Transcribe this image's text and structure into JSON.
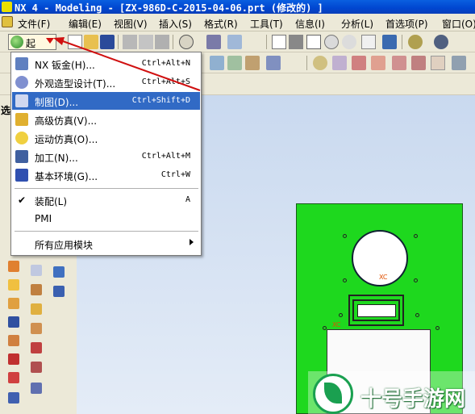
{
  "window": {
    "title": "NX 4 - Modeling - [ZX-986D-C-2015-04-06.prt (修改的) ]"
  },
  "menubar": {
    "items": [
      "文件(F)",
      "编辑(E)",
      "视图(V)",
      "插入(S)",
      "格式(R)",
      "工具(T)",
      "信息(I)",
      "分析(L)",
      "首选项(P)",
      "窗口(O)"
    ]
  },
  "toolbar": {
    "start_label": "起"
  },
  "left_panel": {
    "label": "选"
  },
  "start_menu": {
    "items": [
      {
        "label": "NX 钣金(H)...",
        "shortcut": "Ctrl+Alt+N",
        "icon": "sheetmetal-icon"
      },
      {
        "label": "外观造型设计(T)...",
        "shortcut": "Ctrl+Alt+S",
        "icon": "shape-studio-icon"
      },
      {
        "label": "制图(D)...",
        "shortcut": "Ctrl+Shift+D",
        "icon": "drafting-icon"
      },
      {
        "label": "高级仿真(V)...",
        "shortcut": "",
        "icon": "advanced-simulation-icon"
      },
      {
        "label": "运动仿真(O)...",
        "shortcut": "",
        "icon": "motion-simulation-icon"
      },
      {
        "label": "加工(N)...",
        "shortcut": "Ctrl+Alt+M",
        "icon": "manufacturing-icon"
      },
      {
        "label": "基本环境(G)...",
        "shortcut": "Ctrl+W",
        "icon": "gateway-icon"
      }
    ],
    "assembly": {
      "label": "装配(L)",
      "shortcut": "A"
    },
    "pmi": {
      "label": "PMI"
    },
    "all_apps": {
      "label": "所有应用模块"
    }
  },
  "graphics": {
    "xc_label_top": "XC",
    "xc_label_bottom": "XC"
  },
  "watermark": {
    "text": "十号手游网"
  },
  "colors": {
    "title_bar": "#0a5fe0",
    "highlight": "#316ac5",
    "part_fill": "#1ed81e",
    "annotation_arrow": "#d01010",
    "watermark": "#1aa050"
  }
}
